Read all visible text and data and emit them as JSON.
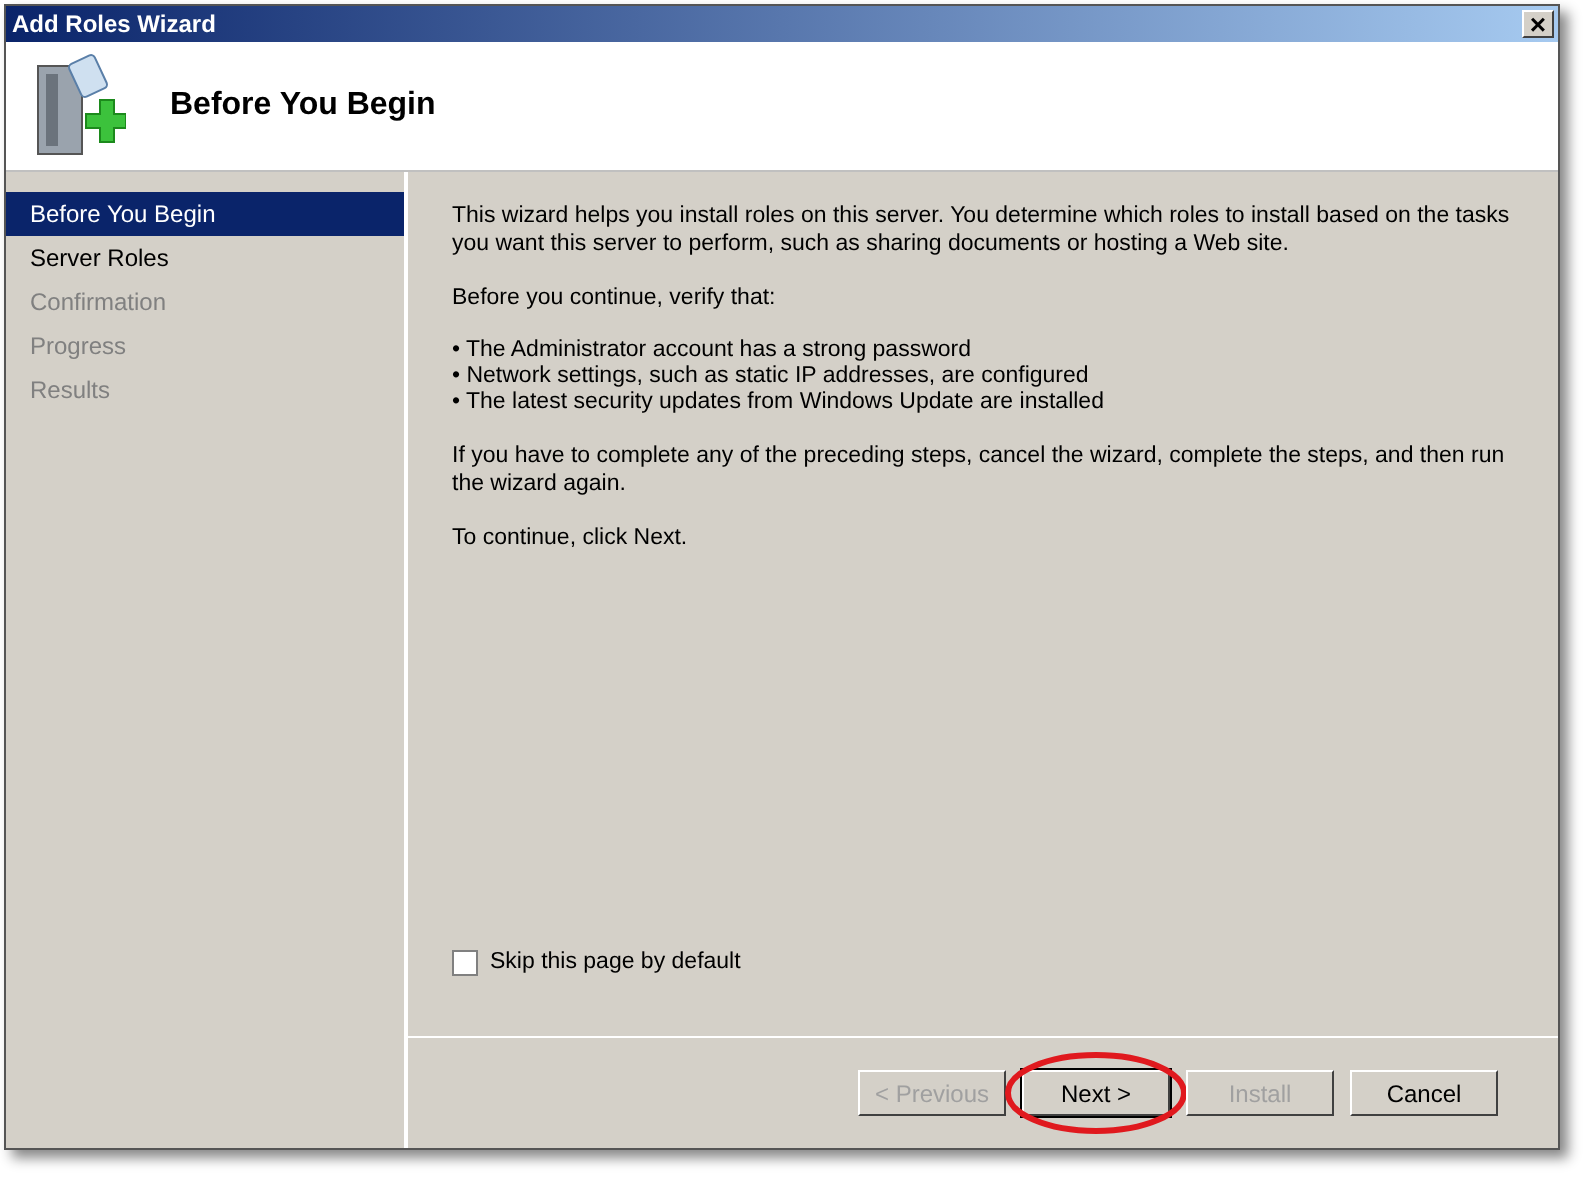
{
  "window": {
    "title": "Add Roles Wizard",
    "close": "×"
  },
  "header": {
    "title": "Before You Begin"
  },
  "sidebar": {
    "items": [
      {
        "label": "Before You Begin",
        "selected": true,
        "disabled": false
      },
      {
        "label": "Server Roles",
        "selected": false,
        "disabled": false
      },
      {
        "label": "Confirmation",
        "selected": false,
        "disabled": true
      },
      {
        "label": "Progress",
        "selected": false,
        "disabled": true
      },
      {
        "label": "Results",
        "selected": false,
        "disabled": true
      }
    ]
  },
  "content": {
    "intro": "This wizard helps you install roles on this server. You determine which roles to install based on the tasks you want this server to perform, such as sharing documents or hosting a Web site.",
    "verify": "Before you continue, verify that:",
    "bullets": [
      "• The Administrator account has a strong password",
      "• Network settings, such as static IP addresses, are configured",
      "• The latest security updates from Windows Update are installed"
    ],
    "note": "If you have to complete any of the preceding steps, cancel the wizard, complete the steps, and then run the wizard again.",
    "continue": "To continue, click Next."
  },
  "skip_checkbox": {
    "label": "Skip this page by default",
    "checked": false
  },
  "buttons": [
    {
      "label": "< Previous",
      "disabled": true,
      "default": false,
      "circled": false
    },
    {
      "label": "Next >",
      "disabled": false,
      "default": true,
      "circled": true
    },
    {
      "label": "Install",
      "disabled": true,
      "default": false,
      "circled": false
    },
    {
      "label": "Cancel",
      "disabled": false,
      "default": false,
      "circled": false
    }
  ]
}
